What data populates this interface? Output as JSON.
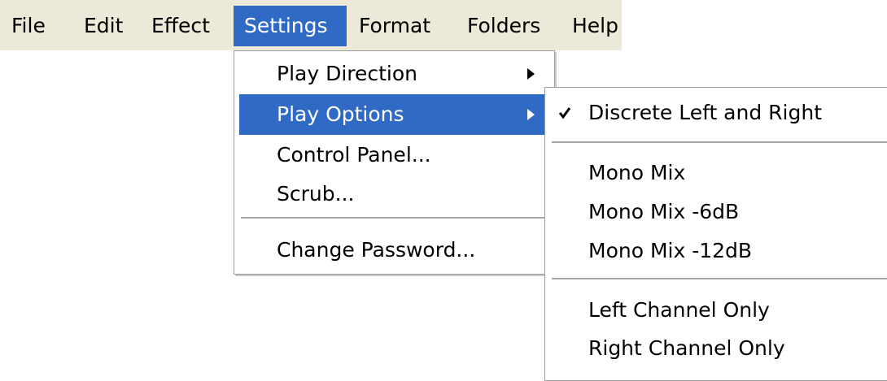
{
  "menubar": {
    "items": [
      "File",
      "Edit",
      "Effect",
      "Settings",
      "Format",
      "Folders",
      "Help"
    ],
    "active": "Settings"
  },
  "settings_menu": {
    "items": [
      {
        "label": "Play Direction",
        "submenu": true
      },
      {
        "label": "Play Options",
        "submenu": true,
        "highlighted": true
      },
      {
        "label": "Control Panel..."
      },
      {
        "label": "Scrub..."
      },
      {
        "label": "Change Password..."
      }
    ]
  },
  "play_options_submenu": {
    "items": [
      {
        "label": "Discrete Left and Right",
        "checked": true
      },
      {
        "label": "Mono Mix"
      },
      {
        "label": "Mono Mix -6dB"
      },
      {
        "label": "Mono Mix -12dB"
      },
      {
        "label": "Left Channel Only"
      },
      {
        "label": "Right Channel Only"
      }
    ]
  },
  "icons": {
    "submenu_arrow": "arrow-right-icon",
    "checkmark": "check-icon"
  },
  "colors": {
    "menubar_bg": "#ece9d8",
    "highlight": "#316ac5",
    "menu_bg": "#ffffff",
    "separator": "#a6a6a6"
  }
}
